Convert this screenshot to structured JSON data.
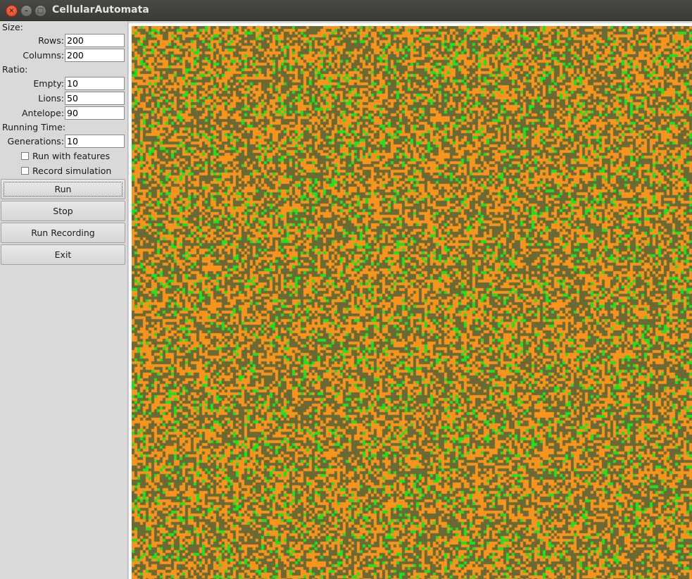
{
  "window": {
    "title": "CellularAutomata"
  },
  "size": {
    "section_label": "Size:",
    "rows_label": "Rows:",
    "rows_value": "200",
    "columns_label": "Columns:",
    "columns_value": "200"
  },
  "ratio": {
    "section_label": "Ratio:",
    "empty_label": "Empty:",
    "empty_value": "10",
    "lions_label": "Lions:",
    "lions_value": "50",
    "antelope_label": "Antelope:",
    "antelope_value": "90"
  },
  "running_time": {
    "section_label": "Running Time:",
    "generations_label": "Generations:",
    "generations_value": "10"
  },
  "options": {
    "run_with_features_label": "Run with features",
    "run_with_features_checked": false,
    "record_simulation_label": "Record simulation",
    "record_simulation_checked": false
  },
  "buttons": {
    "run": "Run",
    "stop": "Stop",
    "run_recording": "Run Recording",
    "exit": "Exit"
  },
  "grid": {
    "colors": {
      "empty": "#6b6a35",
      "lion": "#f7941d",
      "antelope": "#22e01e",
      "border": "#ffffff"
    }
  }
}
